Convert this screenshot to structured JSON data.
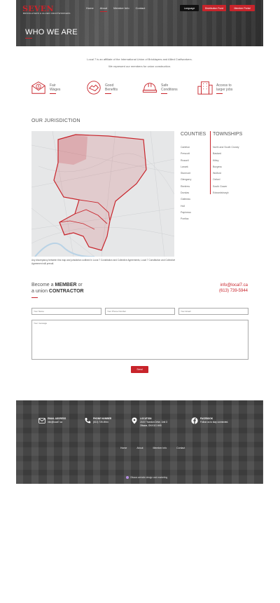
{
  "header": {
    "logo_text": "SEVEN",
    "logo_sub": "BRICKLAYERS & ALLIED CRAFTWORKERS",
    "nav": [
      "Home",
      "About",
      "Member Info",
      "Contact"
    ],
    "active_nav": "About",
    "language_label": "Language",
    "distribution_fund_label": "Distribution Fund",
    "member_portal_label": "Member Portal",
    "brand_color": "#c8242b"
  },
  "hero": {
    "title": "WHO WE ARE"
  },
  "intro": {
    "line1": "Local 7 is an affiliate of the International Union of Bricklayers and Allied Craftworkers.",
    "line2": "We represent our members for union construction."
  },
  "features": [
    {
      "label_line1": "Fair",
      "label_line2": "Wages",
      "icon": "envelope-dollar-icon"
    },
    {
      "label_line1": "Good",
      "label_line2": "Benefits",
      "icon": "handshake-icon"
    },
    {
      "label_line1": "Safe",
      "label_line2": "Conditions",
      "icon": "hard-hat-icon"
    },
    {
      "label_line1": "Access to",
      "label_line2": "larger jobs",
      "icon": "building-icon"
    }
  ],
  "jurisdiction": {
    "title": "OUR JURISDICTION",
    "note": "Any discrepancy between this map and jurisdiction outlined in Local 7 Constitution and Collective Agreements, Local 7 Constitution and Collective Agreement will prevail.",
    "counties_title": "COUNTIES",
    "counties": [
      "Carleton",
      "Prescott",
      "Russell",
      "Lanark",
      "Stormont",
      "Glengarry",
      "Renfrew",
      "Dundas",
      "Gatineau",
      "Hull",
      "Papineau",
      "Pontiac"
    ],
    "townships_title": "TOWNSHIPS",
    "townships": [
      "North and South Crosby",
      "Bastard",
      "Kitley",
      "Burgess",
      "Wolford",
      "Oxford",
      "South Gower",
      "Edwardsburgh"
    ]
  },
  "member": {
    "title_pre1": "Become a ",
    "title_bold1": "MEMBER",
    "title_mid": " or",
    "title_pre2": "a union ",
    "title_bold2": "CONTRACTOR",
    "email": "info@local7.ca",
    "phone": "(613) 739-5944",
    "name_placeholder": "Your Name",
    "phone_placeholder": "Your Phone Number",
    "email_placeholder": "Your Email",
    "message_placeholder": "Your message",
    "send_label": "Send"
  },
  "footer": {
    "email_title": "EMAIL ADDRESS",
    "email_value": "info@local7.ca",
    "phone_title": "PHONE NUMBER",
    "phone_value": "(613) 739-5944",
    "location_title": "LOCATION",
    "location_line1": "2100 Thurston Drive, Unit 3",
    "location_line2": "Ottawa, ON K1G 4K8",
    "facebook_title": "FACEBOOK",
    "facebook_value": "Follow us to stay connected.",
    "nav": [
      "Home",
      "About",
      "Member Info",
      "Contact"
    ],
    "credit": "Ottawa website design and marketing"
  }
}
